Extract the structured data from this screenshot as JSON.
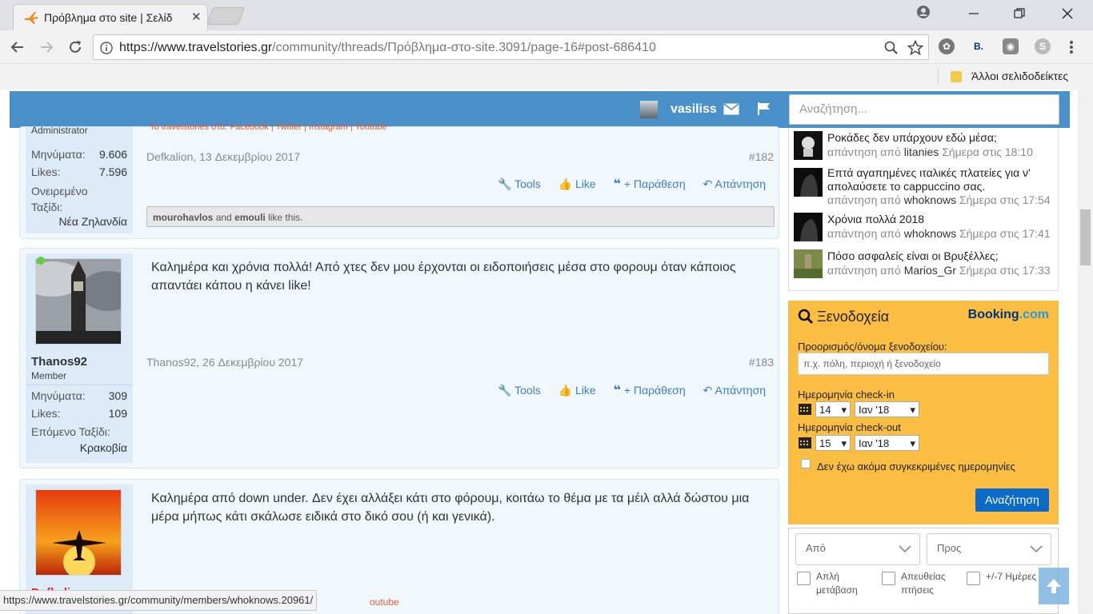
{
  "browser": {
    "tab_title": "Πρόβλημα στο site | Σελίδ",
    "tab_close": "✕",
    "url_domain": "https://www.travelstories.gr",
    "url_path": "/community/threads/Πρόβλημα-στο-site.3091/page-16#post-686410",
    "bookmark_other": "Άλλοι σελιδοδείκτες",
    "extension_b": "B.",
    "status_url": "https://www.travelstories.gr/community/members/whoknows.20961/"
  },
  "site": {
    "username": "vasiliss",
    "search_placeholder": "Αναζήτηση..."
  },
  "posts": [
    {
      "user_role": "Administrator",
      "stats": [
        {
          "label": "Μηνύματα:",
          "value": "9.606"
        },
        {
          "label": "Likes:",
          "value": "7.596"
        }
      ],
      "dream_label": "Ονειρεμένο Ταξίδι:",
      "dream_value": "Νέα Ζηλανδία",
      "social_fragment": "Το travelstories στα: Facebook | Twitter | Instagram | Youtube",
      "meta": "Defkalion, 13 Δεκεμβρίου 2017",
      "number": "#182",
      "likes_users": [
        "mourohavlos",
        "emouli"
      ],
      "likes_and": "and",
      "likes_suffix": "like this."
    },
    {
      "username": "Thanos92",
      "user_role": "Member",
      "stats": [
        {
          "label": "Μηνύματα:",
          "value": "309"
        },
        {
          "label": "Likes:",
          "value": "109"
        }
      ],
      "next_label": "Επόμενο Ταξίδι:",
      "next_value": "Κρακοβία",
      "message": "Καλημέρα και χρόνια πολλά! Από χτες δεν μου έρχονται οι ειδοποιήσεις μέσα στο φορουμ όταν κάποιος απαντάει κάπου η κάνει like!",
      "meta": "Thanos92, 26 Δεκεμβρίου 2017",
      "number": "#183"
    },
    {
      "username": "Defkalion",
      "message": "Καλημέρα από down under. Δεν έχει αλλάξει κάτι στο φόρουμ, κοιτάω το θέμα με τα μέιλ αλλά δώστου μια μέρα μήπως κάτι σκάλωσε ειδικά στο δικό σου (ή και γενικά).",
      "footer_fragment": "outube"
    }
  ],
  "actions": {
    "tools": "Tools",
    "like": "Like",
    "quote": "+ Παράθεση",
    "reply": "Απάντηση"
  },
  "recent_threads": [
    {
      "title": "Ροκάδες δεν υπάρχουν εδώ μέσα;",
      "prefix": "απάντηση από",
      "user": "litanies",
      "time": "Σήμερα στις 18:10"
    },
    {
      "title": "Επτά αγαπημένες ιταλικές πλατείες για ν' απολαύσετε το cappuccino σας.",
      "prefix": "απάντηση από",
      "user": "whoknows",
      "time": "Σήμερα στις 17:54"
    },
    {
      "title": "Χρόνια πολλά 2018",
      "prefix": "απάντηση από",
      "user": "whoknows",
      "time": "Σήμερα στις 17:41"
    },
    {
      "title": "Πόσο ασφαλείς είναι οι Βρυξέλλες;",
      "prefix": "απάντηση από",
      "user": "Marios_Gr",
      "time": "Σήμερα στις 17:33"
    }
  ],
  "booking": {
    "title": "Ξενοδοχεία",
    "brand_main": "Booking",
    "brand_suffix": ".com",
    "dest_label": "Προορισμός/όνομα ξενοδοχείου:",
    "dest_placeholder": "π.χ. πόλη, περιοχή ή ξενοδοχείο",
    "checkin_label": "Ημερομηνία check-in",
    "checkin_day": "14",
    "checkin_month": "Ιαν '18",
    "checkout_label": "Ημερομηνία check-out",
    "checkout_day": "15",
    "checkout_month": "Ιαν '18",
    "no_dates_label": "Δεν έχω ακόμα συγκεκριμένες ημερομηνίες",
    "search_button": "Αναζήτηση",
    "colors": {
      "background": "#fbbe42",
      "button": "#0b6bc7",
      "brand_dark": "#003580",
      "brand_light": "#2a9bd6"
    }
  },
  "flights": {
    "from_placeholder": "Από",
    "to_placeholder": "Προς",
    "options": [
      "Απλή μετάβαση",
      "Απευθείας πτήσεις",
      "+/-7 Ημέρες"
    ]
  },
  "icons": [
    "plane-favicon",
    "back-arrow-icon",
    "forward-arrow-icon",
    "reload-icon",
    "info-icon",
    "zoom-icon",
    "star-icon",
    "envelope-icon",
    "flag-icon",
    "wrench-icon",
    "thumbs-up-icon",
    "quote-icon",
    "reply-icon",
    "search-icon",
    "calendar-icon",
    "chevron-down-icon",
    "arrow-up-icon"
  ],
  "colors": {
    "site_header": "#4a90c9",
    "link": "#3b7fc4",
    "post_bg": "#f0f7fd",
    "user_col_bg": "#dcebf7"
  }
}
